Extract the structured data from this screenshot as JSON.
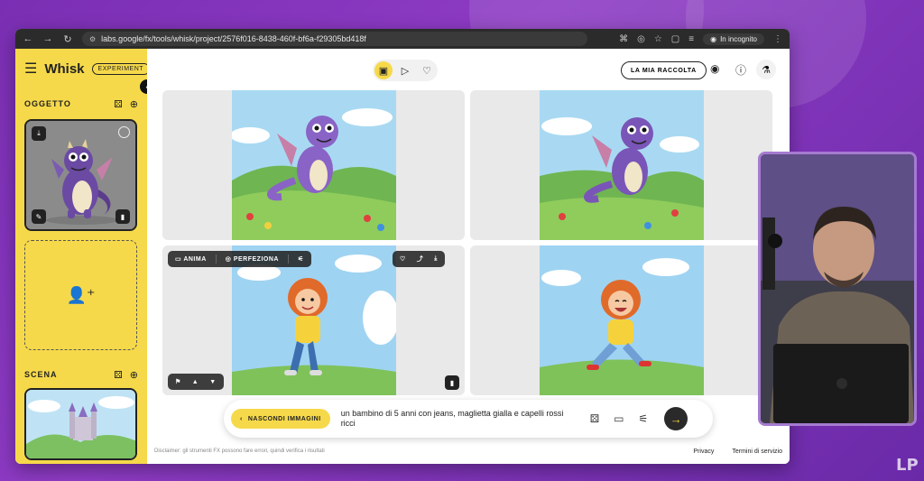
{
  "browser": {
    "url": "labs.google/fx/tools/whisk/project/2576f016-8438-460f-bf6a-f29305bd418f",
    "incognito_label": "In incognito",
    "nav_icons": [
      "back-arrow-icon",
      "forward-arrow-icon",
      "reload-icon"
    ]
  },
  "sidebar": {
    "brand": "Whisk",
    "badge": "EXPERIMENT",
    "section_subject": "OGGETTO",
    "section_scene": "SCENA"
  },
  "topbar": {
    "collection_label": "LA MIA RACCOLTA"
  },
  "overlay": {
    "animate_label": "ANIMA",
    "refine_label": "PERFEZIONA"
  },
  "prompt": {
    "hide_images_label": "NASCONDI IMMAGINI",
    "text": "un bambino di 5 anni con jeans, maglietta gialla e capelli rossi ricci"
  },
  "footer": {
    "disclaimer": "Disclaimer: gli strumenti FX possono fare errori, quindi verifica i risultati",
    "privacy": "Privacy",
    "terms": "Termini di servizio"
  },
  "colors": {
    "accent_yellow": "#f6d94a",
    "background_purple": "#7a2fb3",
    "dark": "#222222"
  },
  "watermark": "LP"
}
